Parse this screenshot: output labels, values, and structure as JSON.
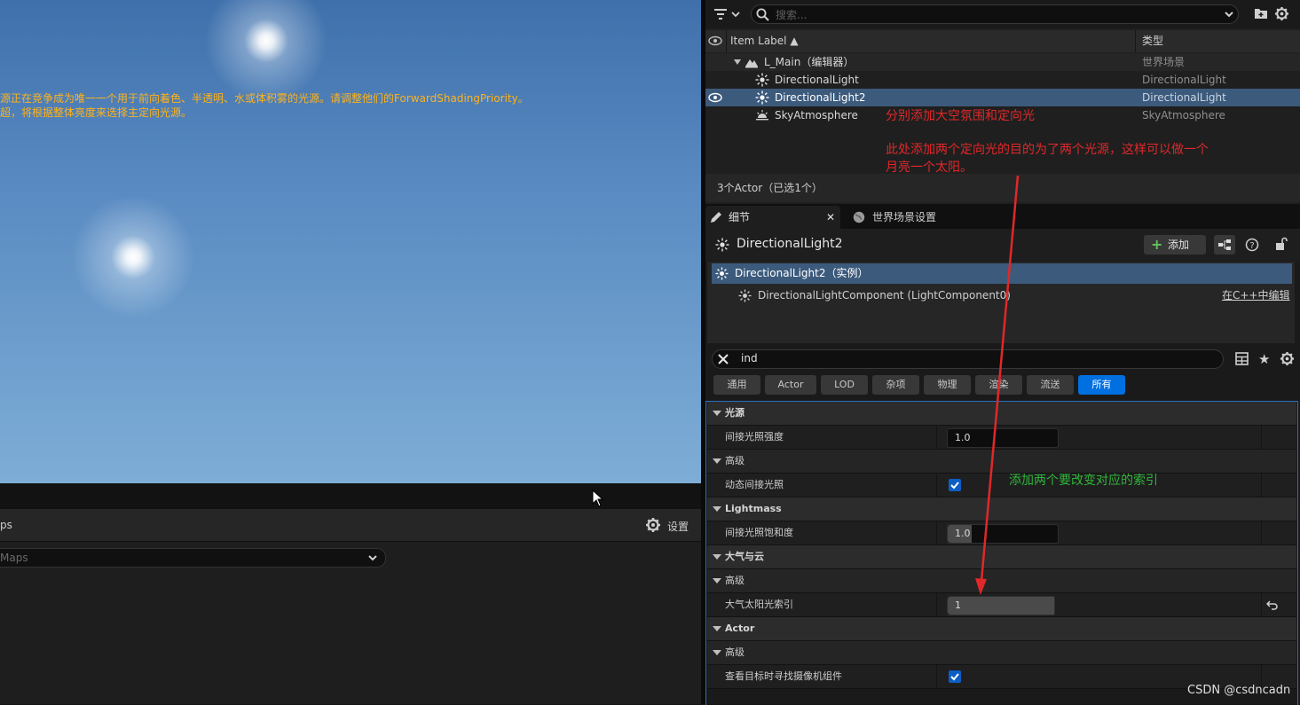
{
  "viewport": {
    "warning_line1": "源正在竞争成为唯一一个用于前向着色、半透明、水或体积雾的光源。请调整他们的ForwardShadingPriority。",
    "warning_line2": "超，将根据整体亮度来选择主定向光源。"
  },
  "bottom_panel": {
    "title": "ps",
    "settings_label": "设置",
    "dropdown_value": "Maps"
  },
  "outliner": {
    "search_placeholder": "搜索...",
    "col_label": "Item Label ▲",
    "col_type": "类型",
    "rows": [
      {
        "label": "L_Main（编辑器）",
        "type": "世界场景",
        "icon": "level-icon"
      },
      {
        "label": "DirectionalLight",
        "type": "DirectionalLight",
        "icon": "directional-light-icon"
      },
      {
        "label": "DirectionalLight2",
        "type": "DirectionalLight",
        "icon": "directional-light-icon"
      },
      {
        "label": "SkyAtmosphere",
        "type": "SkyAtmosphere",
        "icon": "sky-atmosphere-icon"
      }
    ],
    "status": "3个Actor（已选1个）"
  },
  "annotations": {
    "note1": "分别添加大空氛围和定向光",
    "note2_line1": "此处添加两个定向光的目的为了两个光源，这样可以做一个",
    "note2_line2": "月亮一个太阳。",
    "note3": "添加两个要改变对应的索引",
    "color_red": "#e0282a",
    "color_green": "#2fb53a"
  },
  "details": {
    "tab_details": "细节",
    "tab_world": "世界场景设置",
    "object_name": "DirectionalLight2",
    "add_button": "添加",
    "instance_label": "DirectionalLight2（实例）",
    "component_label": "DirectionalLightComponent (LightComponent0)",
    "edit_cpp": "在C++中编辑",
    "search_value": "ind",
    "filters": [
      "通用",
      "Actor",
      "LOD",
      "杂项",
      "物理",
      "渲染",
      "流送",
      "所有"
    ],
    "rows": [
      {
        "kind": "cat",
        "label": "光源"
      },
      {
        "kind": "prop",
        "label": "间接光照强度",
        "value": "1.0",
        "fill": 0.0
      },
      {
        "kind": "sub",
        "label": "高级"
      },
      {
        "kind": "prop",
        "label": "动态间接光照",
        "checked": true
      },
      {
        "kind": "cat",
        "label": "Lightmass"
      },
      {
        "kind": "prop",
        "label": "间接光照饱和度",
        "value": "1.0",
        "fill": 0.22
      },
      {
        "kind": "cat",
        "label": "大气与云"
      },
      {
        "kind": "sub",
        "label": "高级"
      },
      {
        "kind": "prop",
        "label": "大气太阳光索引",
        "value": "1",
        "fill": 1.0,
        "reset": true
      },
      {
        "kind": "cat",
        "label": "Actor"
      },
      {
        "kind": "sub",
        "label": "高级"
      },
      {
        "kind": "prop",
        "label": "查看目标时寻找摄像机组件",
        "checked": true
      }
    ],
    "accent": "#0070e0"
  },
  "watermark": "CSDN @csdncadn"
}
